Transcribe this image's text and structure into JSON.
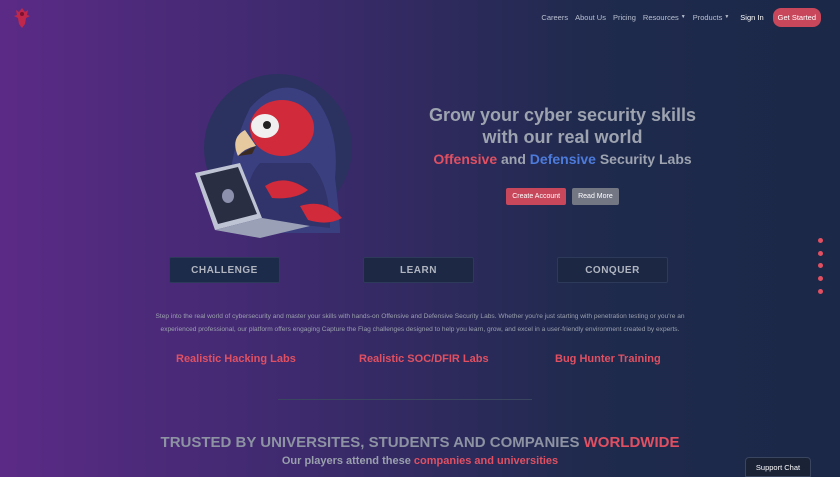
{
  "nav": {
    "items": [
      {
        "label": "Careers",
        "dropdown": false
      },
      {
        "label": "About Us",
        "dropdown": false
      },
      {
        "label": "Pricing",
        "dropdown": false
      },
      {
        "label": "Resources",
        "dropdown": true
      },
      {
        "label": "Products",
        "dropdown": true
      }
    ],
    "signin": "Sign In",
    "get_started": "Get Started"
  },
  "hero": {
    "line1": "Grow your cyber security skills",
    "line2": "with our real world",
    "offensive": "Offensive",
    "and": "and",
    "defensive": "Defensive",
    "security_labs": "Security Labs",
    "create_account": "Create Account",
    "read_more": "Read More"
  },
  "pillars": [
    "CHALLENGE",
    "LEARN",
    "CONQUER"
  ],
  "description": "Step into the real world of cybersecurity and master your skills with hands-on Offensive and Defensive Security Labs. Whether you're just starting with penetration testing or you're an experienced professional, our platform offers engaging Capture the Flag challenges designed to help you learn, grow, and excel in a user-friendly environment created by experts.",
  "features": [
    "Realistic Hacking Labs",
    "Realistic SOC/DFIR Labs",
    "Bug Hunter Training"
  ],
  "trusted": {
    "main": "TRUSTED BY UNIVERSITES, STUDENTS AND COMPANIES",
    "accent": "WORLDWIDE"
  },
  "players": {
    "main": "Our players attend these",
    "accent": "companies and universities"
  },
  "support_chat": "Support Chat",
  "colors": {
    "accent_red": "#e05062",
    "accent_blue": "#4d7bdc",
    "button_red": "#c8475b"
  },
  "icons": {
    "logo": "red-parrot-logo-icon",
    "hero": "hooded-parrot-hacker-illustration"
  }
}
